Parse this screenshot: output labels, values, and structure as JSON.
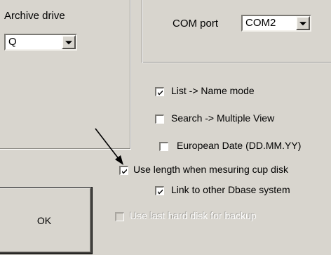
{
  "archive": {
    "label": "Archive drive",
    "value": "Q"
  },
  "com": {
    "label": "COM port",
    "value": "COM2"
  },
  "options": [
    {
      "label": "List -> Name mode",
      "checked": true,
      "enabled": true
    },
    {
      "label": "Search -> Multiple View",
      "checked": false,
      "enabled": true
    },
    {
      "label": "European Date (DD.MM.YY)",
      "checked": false,
      "enabled": true
    },
    {
      "label": "Use length when mesuring cup disk",
      "checked": true,
      "enabled": true
    },
    {
      "label": "Link to other Dbase system",
      "checked": true,
      "enabled": true
    },
    {
      "label": "Use last hard disk for backup",
      "checked": false,
      "enabled": false
    }
  ],
  "buttons": {
    "ok_label": "OK"
  },
  "icons": {
    "dropdown": "chevron-down-icon",
    "check": "check-icon",
    "annotation_arrow": "arrow-icon"
  },
  "colors": {
    "dialog_bg": "#d8d5ce",
    "field_bg": "#ffffff"
  }
}
